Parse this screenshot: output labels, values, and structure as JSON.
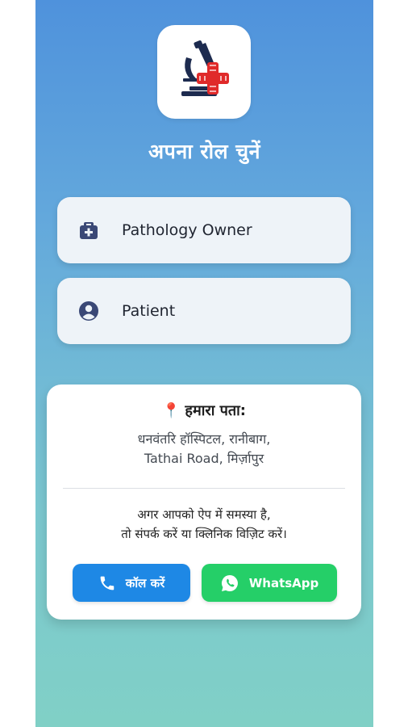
{
  "header": {
    "title": "अपना रोल चुनें"
  },
  "roles": [
    {
      "label": "Pathology Owner",
      "icon": "medical-bag-icon"
    },
    {
      "label": "Patient",
      "icon": "account-circle-icon"
    }
  ],
  "address": {
    "pin_icon": "📍",
    "heading": "हमारा पता:",
    "line1": "धनवंतरि हॉस्पिटल, रानीबाग,",
    "line2": "Tathai Road, मिर्ज़ापुर"
  },
  "help": {
    "line1": "अगर आपको ऐप में समस्या है,",
    "line2": "तो संपर्क करें या क्लिनिक विज़िट करें।"
  },
  "actions": {
    "call_label": "कॉल करें",
    "whatsapp_label": "WhatsApp"
  },
  "colors": {
    "gradient_top": "#4f92dc",
    "gradient_bottom": "#80d0c6",
    "call_button": "#1e88e5",
    "whatsapp_button": "#25cf68",
    "logo_red": "#e02a2a",
    "logo_navy": "#1d2b4f"
  }
}
